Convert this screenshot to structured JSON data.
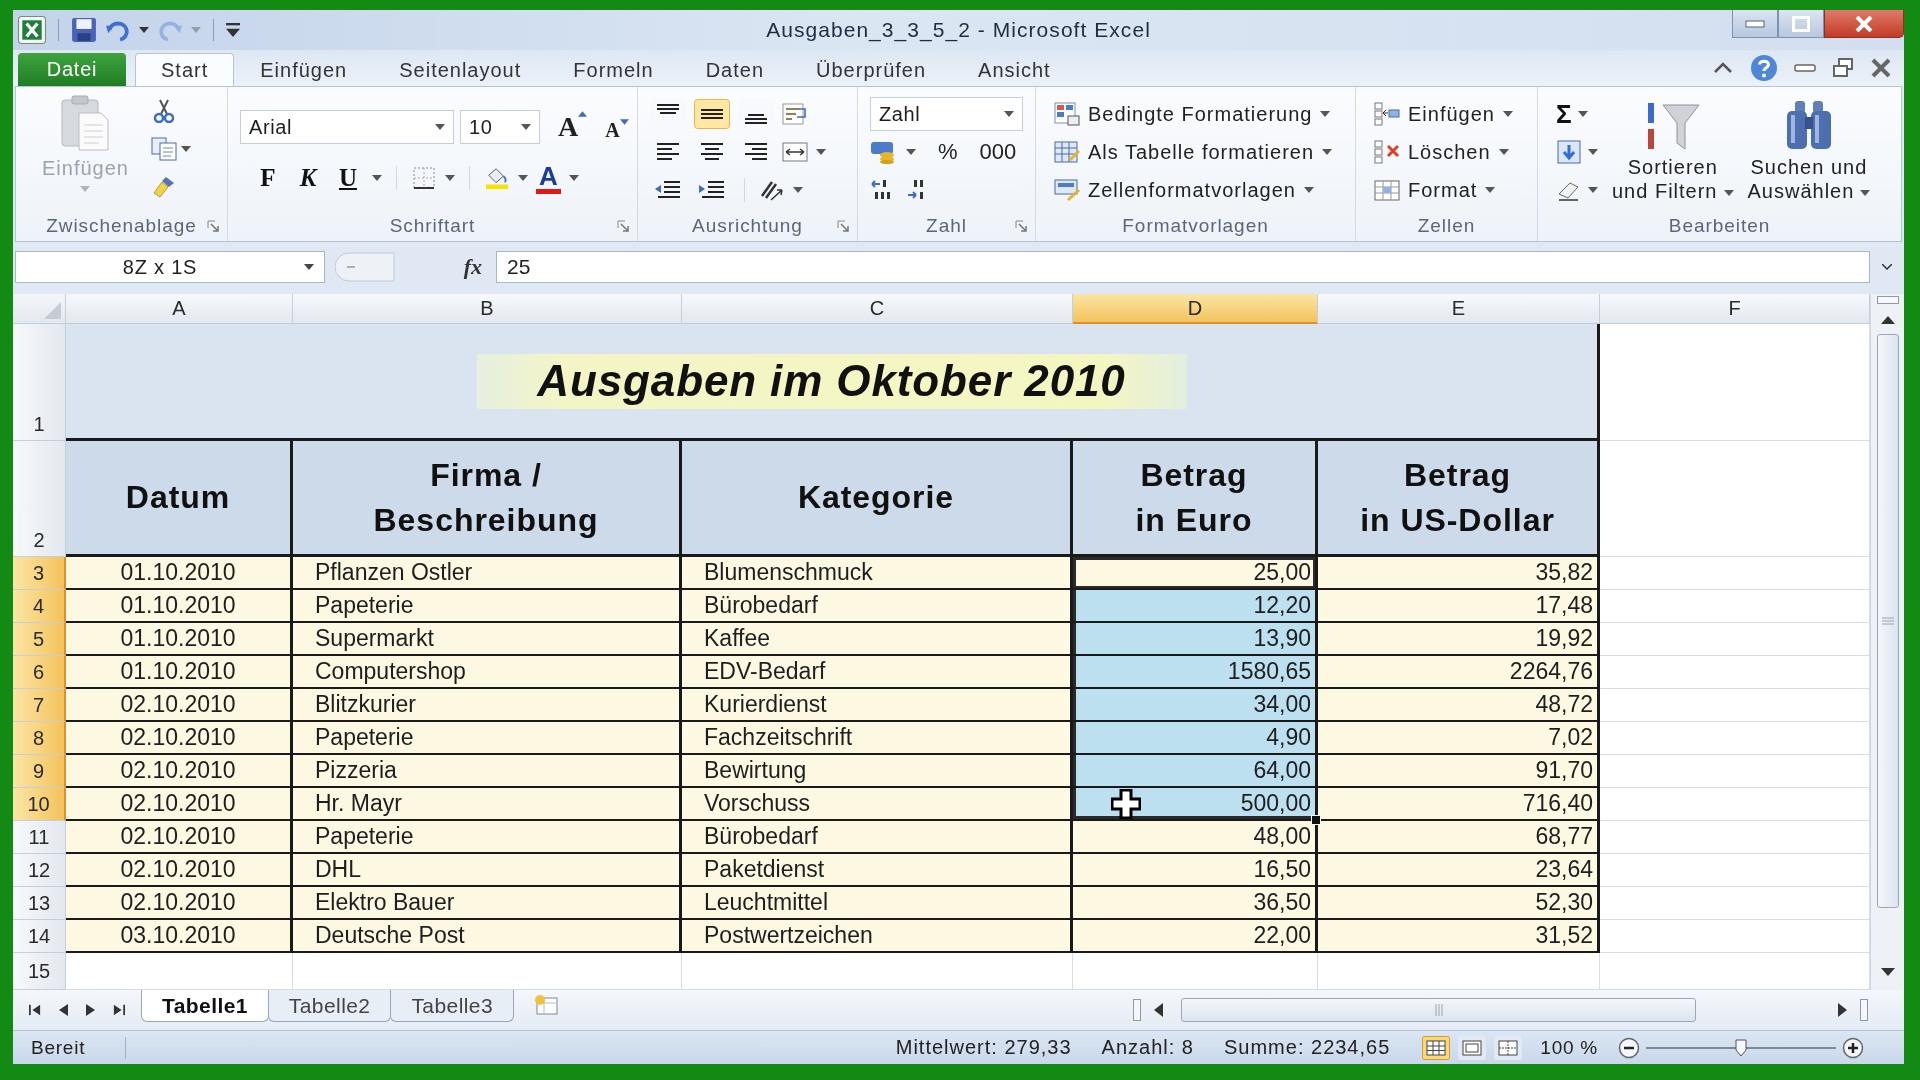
{
  "window": {
    "title": "Ausgaben_3_3_5_2 - Microsoft Excel"
  },
  "quick_access": [
    {
      "kind": "save",
      "disabled": false
    },
    {
      "kind": "undo",
      "disabled": false
    },
    {
      "kind": "redo",
      "disabled": true
    }
  ],
  "tabs": [
    {
      "label": "Datei",
      "kind": "file",
      "selected": false
    },
    {
      "label": "Start",
      "kind": "tab",
      "selected": true
    },
    {
      "label": "Einfügen",
      "kind": "tab",
      "selected": false
    },
    {
      "label": "Seitenlayout",
      "kind": "tab",
      "selected": false
    },
    {
      "label": "Formeln",
      "kind": "tab",
      "selected": false
    },
    {
      "label": "Daten",
      "kind": "tab",
      "selected": false
    },
    {
      "label": "Überprüfen",
      "kind": "tab",
      "selected": false
    },
    {
      "label": "Ansicht",
      "kind": "tab",
      "selected": false
    }
  ],
  "ribbon": {
    "clipboard": {
      "label": "Zwischenablage",
      "paste": {
        "label": "Einfügen",
        "disabled": true
      }
    },
    "font": {
      "label": "Schriftart",
      "font_name": "Arial",
      "font_size": "10",
      "grow_font": "A",
      "shrink_font": "A",
      "bold": "F",
      "italic": "K",
      "underline": "U",
      "font_color": "A"
    },
    "alignment": {
      "label": "Ausrichtung",
      "vertical": [
        {
          "kind": "top",
          "selected": false
        },
        {
          "kind": "middle",
          "selected": true
        },
        {
          "kind": "bottom",
          "selected": false
        }
      ]
    },
    "number": {
      "label": "Zahl",
      "format": "Zahl",
      "percent": "%",
      "thousands": "000"
    },
    "styles": {
      "label": "Formatvorlagen",
      "items": [
        {
          "kind": "conditional",
          "label": "Bedingte Formatierung"
        },
        {
          "kind": "table",
          "label": "Als Tabelle formatieren"
        },
        {
          "kind": "cell_styles",
          "label": "Zellenformatvorlagen"
        }
      ]
    },
    "cells": {
      "label": "Zellen",
      "items": [
        {
          "kind": "insert",
          "label": "Einfügen"
        },
        {
          "kind": "delete",
          "label": "Löschen"
        },
        {
          "kind": "format",
          "label": "Format"
        }
      ]
    },
    "editing": {
      "label": "Bearbeiten",
      "sum": "Σ",
      "sort": "Sortieren\nund Filtern",
      "find": "Suchen und\nAuswählen"
    }
  },
  "formula_bar": {
    "name_box": "8Z x 1S",
    "fx": "fx",
    "formula": "25"
  },
  "sheet": {
    "columns": [
      {
        "label": "A",
        "selected": false
      },
      {
        "label": "B",
        "selected": false
      },
      {
        "label": "C",
        "selected": false
      },
      {
        "label": "D",
        "selected": true
      },
      {
        "label": "E",
        "selected": false
      },
      {
        "label": "F",
        "selected": false
      }
    ],
    "title_row": {
      "number": "1",
      "title": "Ausgaben im Oktober 2010"
    },
    "header_row": {
      "number": "2",
      "cells": [
        "Datum",
        "Firma /\nBeschreibung",
        "Kategorie",
        "Betrag\nin Euro",
        "Betrag\nin US-Dollar"
      ]
    },
    "rows": [
      {
        "number": "3",
        "datum": "01.10.2010",
        "firma": "Pflanzen Ostler",
        "kategorie": "Blumenschmuck",
        "euro": "25,00",
        "usd": "35,82",
        "selected": true,
        "active": true,
        "pointer": false
      },
      {
        "number": "4",
        "datum": "01.10.2010",
        "firma": "Papeterie",
        "kategorie": "Bürobedarf",
        "euro": "12,20",
        "usd": "17,48",
        "selected": true,
        "active": false,
        "pointer": false
      },
      {
        "number": "5",
        "datum": "01.10.2010",
        "firma": "Supermarkt",
        "kategorie": "Kaffee",
        "euro": "13,90",
        "usd": "19,92",
        "selected": true,
        "active": false,
        "pointer": false
      },
      {
        "number": "6",
        "datum": "01.10.2010",
        "firma": "Computershop",
        "kategorie": "EDV-Bedarf",
        "euro": "1580,65",
        "usd": "2264,76",
        "selected": true,
        "active": false,
        "pointer": false
      },
      {
        "number": "7",
        "datum": "02.10.2010",
        "firma": "Blitzkurier",
        "kategorie": "Kurierdienst",
        "euro": "34,00",
        "usd": "48,72",
        "selected": true,
        "active": false,
        "pointer": false
      },
      {
        "number": "8",
        "datum": "02.10.2010",
        "firma": "Papeterie",
        "kategorie": "Fachzeitschrift",
        "euro": "4,90",
        "usd": "7,02",
        "selected": true,
        "active": false,
        "pointer": false
      },
      {
        "number": "9",
        "datum": "02.10.2010",
        "firma": "Pizzeria",
        "kategorie": "Bewirtung",
        "euro": "64,00",
        "usd": "91,70",
        "selected": true,
        "active": false,
        "pointer": false
      },
      {
        "number": "10",
        "datum": "02.10.2010",
        "firma": "Hr. Mayr",
        "kategorie": "Vorschuss",
        "euro": "500,00",
        "usd": "716,40",
        "selected": true,
        "active": false,
        "pointer": true
      },
      {
        "number": "11",
        "datum": "02.10.2010",
        "firma": "Papeterie",
        "kategorie": "Bürobedarf",
        "euro": "48,00",
        "usd": "68,77",
        "selected": false,
        "active": false,
        "pointer": false
      },
      {
        "number": "12",
        "datum": "02.10.2010",
        "firma": "DHL",
        "kategorie": "Paketdienst",
        "euro": "16,50",
        "usd": "23,64",
        "selected": false,
        "active": false,
        "pointer": false
      },
      {
        "number": "13",
        "datum": "02.10.2010",
        "firma": "Elektro Bauer",
        "kategorie": "Leuchtmittel",
        "euro": "36,50",
        "usd": "52,30",
        "selected": false,
        "active": false,
        "pointer": false
      },
      {
        "number": "14",
        "datum": "03.10.2010",
        "firma": "Deutsche Post",
        "kategorie": "Postwertzeichen",
        "euro": "22,00",
        "usd": "31,52",
        "selected": false,
        "active": false,
        "pointer": false
      }
    ],
    "empty_rows": [
      {
        "number": "15"
      }
    ]
  },
  "sheet_tabs": [
    {
      "label": "Tabelle1",
      "selected": true
    },
    {
      "label": "Tabelle2",
      "selected": false
    },
    {
      "label": "Tabelle3",
      "selected": false
    }
  ],
  "status_bar": {
    "mode": "Bereit",
    "stats": [
      "Mittelwert: 279,33",
      "Anzahl: 8",
      "Summe: 2234,65"
    ],
    "views": [
      {
        "kind": "normal",
        "selected": true
      },
      {
        "kind": "page_layout",
        "selected": false
      },
      {
        "kind": "page_break",
        "selected": false
      }
    ],
    "zoom": "100 %",
    "zoom_slider": {
      "level": 0.5
    }
  }
}
